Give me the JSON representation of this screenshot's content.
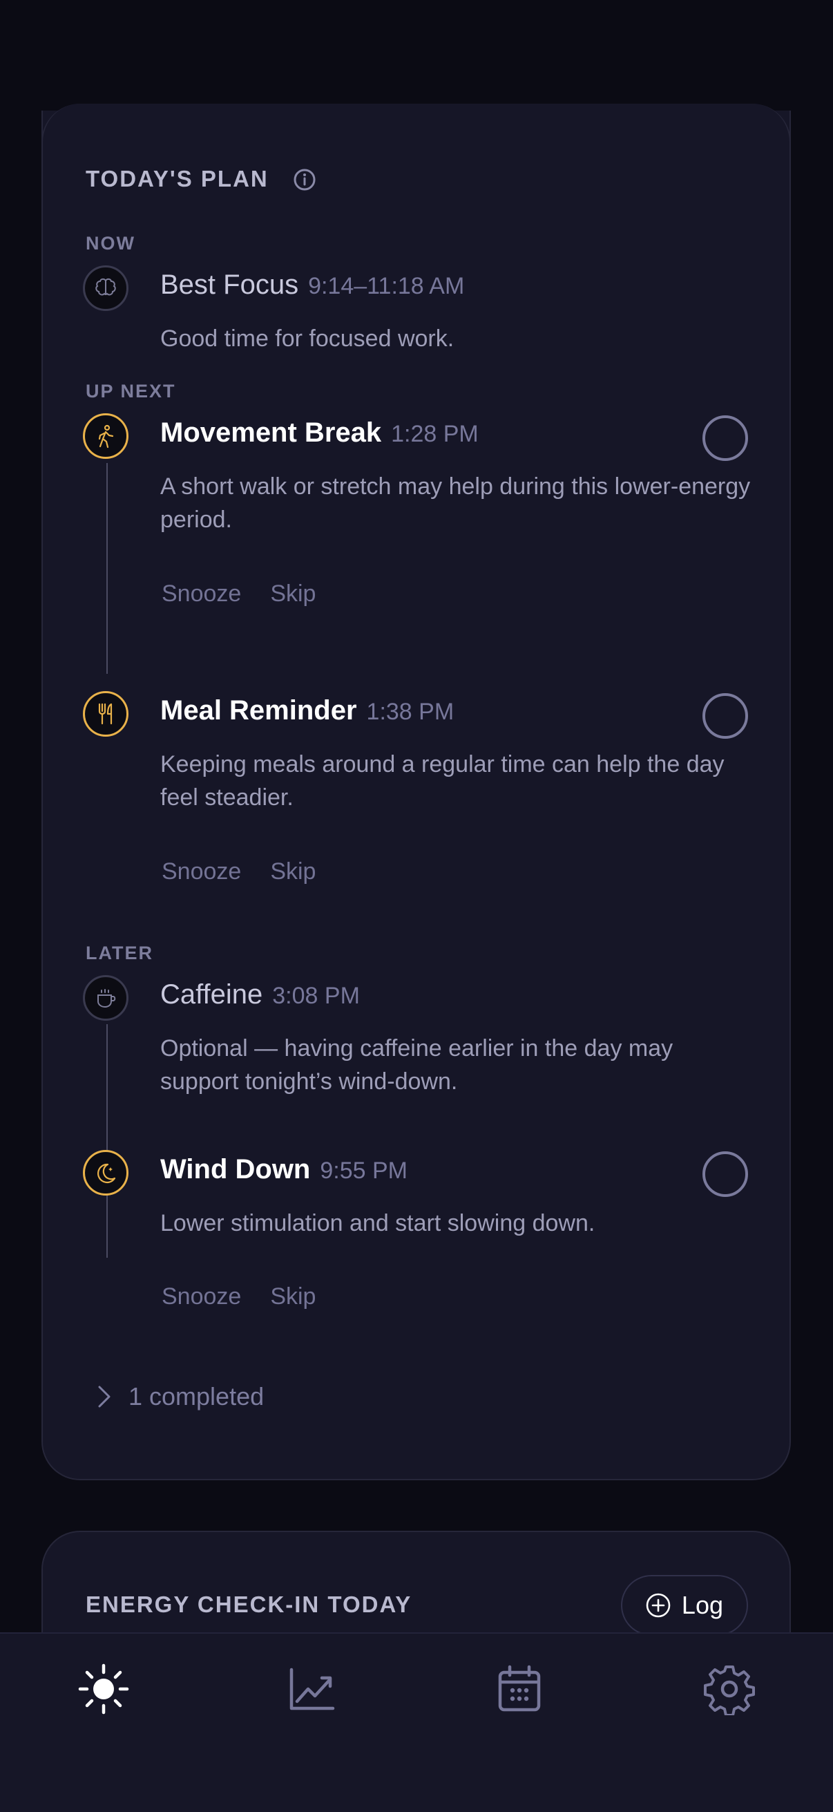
{
  "plan": {
    "title": "TODAY'S PLAN",
    "sections": {
      "now": "NOW",
      "up_next": "UP NEXT",
      "later": "LATER"
    },
    "items": [
      {
        "icon": "brain-icon",
        "title": "Best Focus",
        "time": "9:14–11:18 AM",
        "description": "Good time for focused work."
      },
      {
        "icon": "walking-person-icon",
        "title": "Movement Break",
        "time": "1:28 PM",
        "description": "A short walk or stretch may help during this lower-energy period.",
        "snooze": "Snooze",
        "skip": "Skip"
      },
      {
        "icon": "utensils-icon",
        "title": "Meal Reminder",
        "time": "1:38 PM",
        "description": "Keeping meals around a regular time can help the day feel steadier.",
        "snooze": "Snooze",
        "skip": "Skip"
      },
      {
        "icon": "coffee-cup-icon",
        "title": "Caffeine",
        "time": "3:08 PM",
        "description": "Optional — having caffeine earlier in the day may support tonight’s wind-down."
      },
      {
        "icon": "moon-icon",
        "title": "Wind Down",
        "time": "9:55 PM",
        "description": "Lower stimulation and start slowing down.",
        "snooze": "Snooze",
        "skip": "Skip"
      }
    ],
    "completed_label": "1 completed"
  },
  "energy": {
    "title": "ENERGY CHECK-IN TODAY",
    "log_label": "Log"
  },
  "tabbar": {
    "tabs": [
      "sun-icon",
      "trend-chart-icon",
      "calendar-icon",
      "gear-icon"
    ],
    "active": "sun-icon"
  },
  "colors": {
    "background": "#0b0b14",
    "card": "#161627",
    "accent": "#e9b24a",
    "muted_text": "#77779a"
  }
}
